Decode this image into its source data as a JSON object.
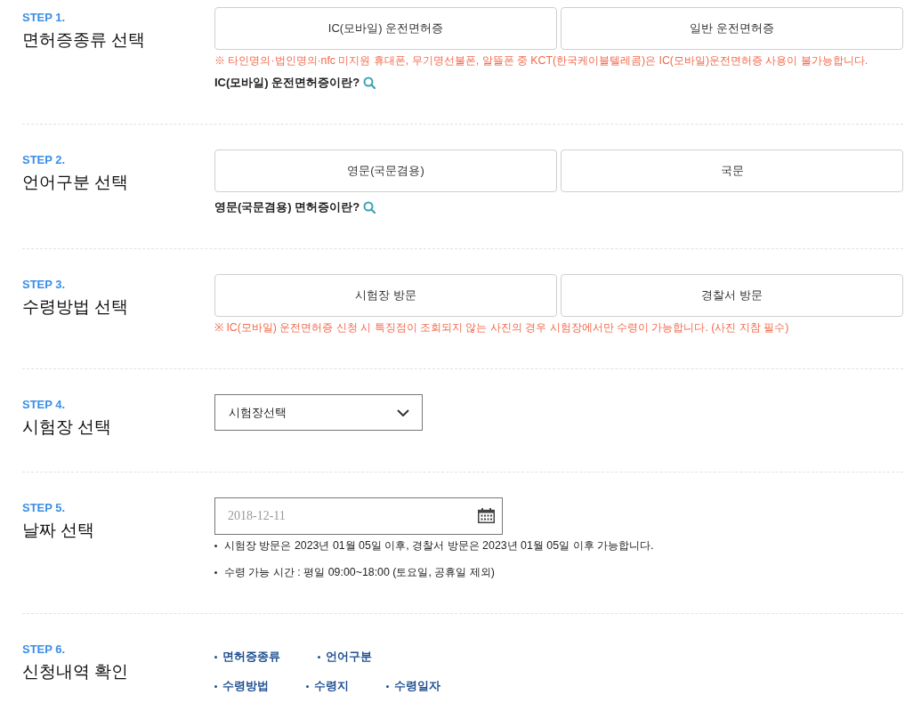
{
  "steps": [
    {
      "step": "STEP 1.",
      "title": "면허증종류 선택",
      "kind": "options",
      "options": [
        {
          "label": "IC(모바일) 운전면허증",
          "selected": false
        },
        {
          "label": "일반 운전면허증",
          "selected": false
        }
      ],
      "notice": "※ 타인명의·법인명의·nfc 미지원 휴대폰, 무기명선불폰, 알뜰폰 중 KCT(한국케이블텔레콤)은 IC(모바일)운전면허증 사용이 불가능합니다.",
      "info_link": "IC(모바일) 운전면허증이란?"
    },
    {
      "step": "STEP 2.",
      "title": "언어구분 선택",
      "kind": "options",
      "options": [
        {
          "label": "영문(국문겸용)",
          "selected": false
        },
        {
          "label": "국문",
          "selected": false
        }
      ],
      "info_link": "영문(국문겸용) 면허증이란?"
    },
    {
      "step": "STEP 3.",
      "title": "수령방법 선택",
      "kind": "options",
      "options": [
        {
          "label": "시험장 방문",
          "selected": false
        },
        {
          "label": "경찰서 방문",
          "selected": false
        }
      ],
      "notice": "※ IC(모바일) 운전면허증 신청 시 특징점이 조회되지 않는 사진의 경우 시험장에서만 수령이 가능합니다. (사진 지참 필수)"
    },
    {
      "step": "STEP 4.",
      "title": "시험장 선택",
      "kind": "select",
      "select": {
        "value": "시험장선택"
      }
    },
    {
      "step": "STEP 5.",
      "title": "날짜 선택",
      "kind": "date",
      "date_field": {
        "placeholder": "2018-12-11"
      },
      "notes": [
        "시험장 방문은 2023년 01월 05일 이후, 경찰서 방문은 2023년 01월 05일 이후 가능합니다.",
        "수령 가능 시간 : 평일 09:00~18:00 (토요일, 공휴일 제외)"
      ]
    },
    {
      "step": "STEP 6.",
      "title": "신청내역 확인",
      "kind": "summary",
      "summary_rows": [
        [
          "면허증종류",
          "언어구분"
        ],
        [
          "수령방법",
          "수령지",
          "수령일자"
        ]
      ]
    }
  ]
}
